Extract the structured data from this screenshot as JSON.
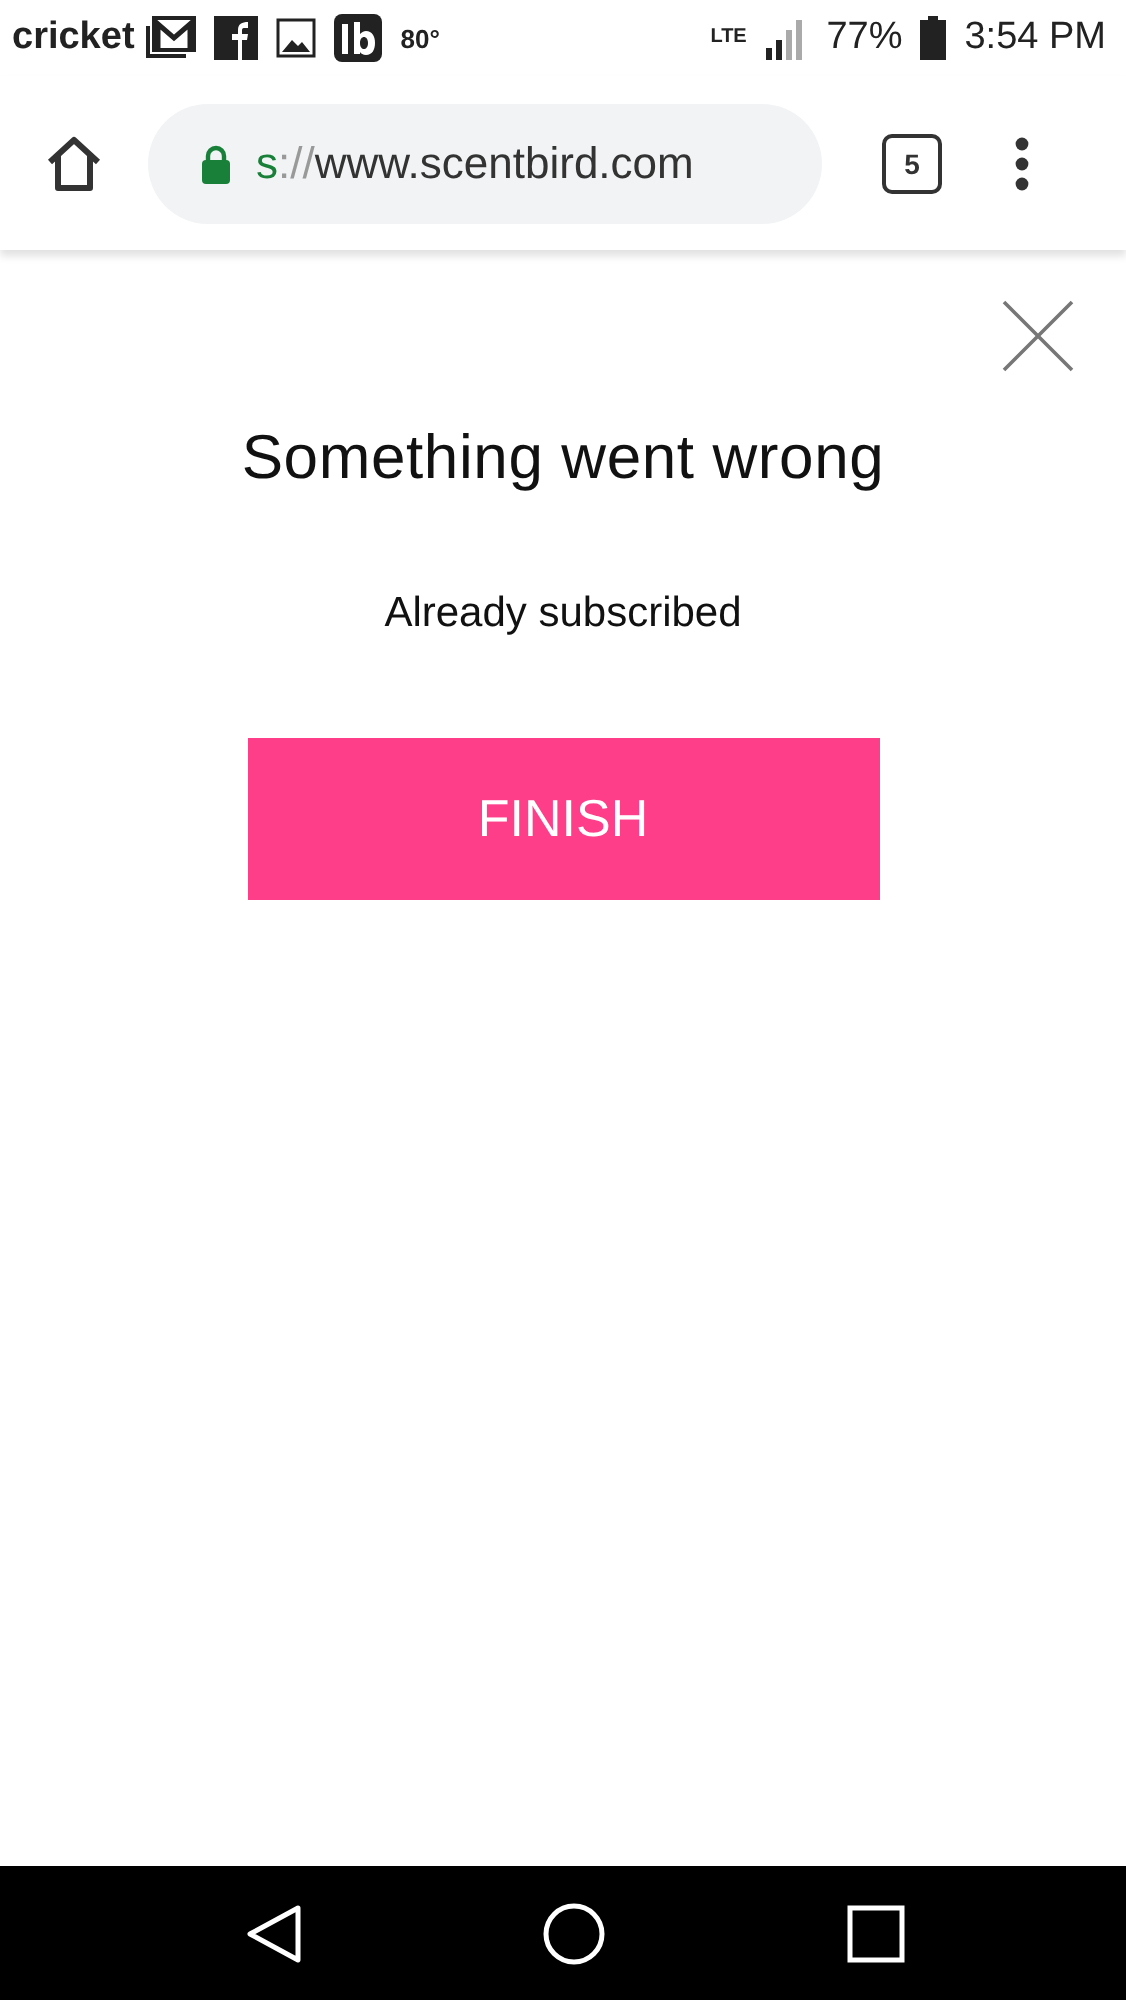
{
  "status_bar": {
    "carrier": "cricket",
    "temperature": "80°",
    "network": "LTE",
    "battery": "77%",
    "time": "3:54 PM"
  },
  "browser": {
    "url_parts": [
      {
        "kind": "scheme",
        "text": "s"
      },
      {
        "kind": "separator",
        "text": "://"
      },
      {
        "kind": "host",
        "text": "www.scentbird.com"
      }
    ],
    "tab_count": "5"
  },
  "dialog": {
    "title": "Something went wrong",
    "message": "Already subscribed",
    "button": "FINISH"
  }
}
